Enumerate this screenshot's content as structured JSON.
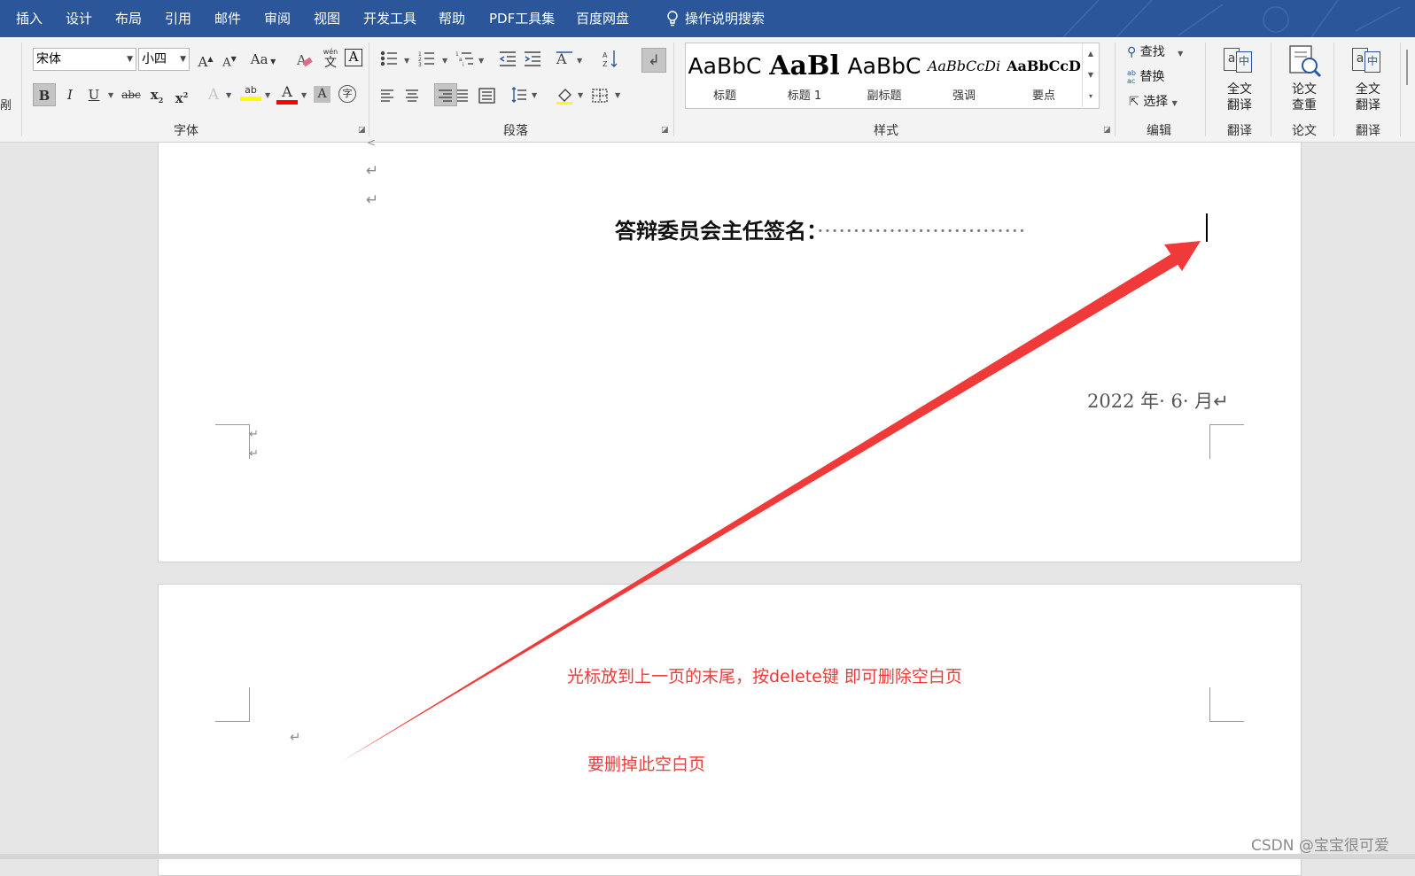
{
  "menu": {
    "tabs": [
      "插入",
      "设计",
      "布局",
      "引用",
      "邮件",
      "审阅",
      "视图",
      "开发工具",
      "帮助",
      "PDF工具集",
      "百度网盘"
    ],
    "tell_me": "操作说明搜索"
  },
  "ribbon": {
    "font": {
      "name": "宋体",
      "size": "小四",
      "label": "字体",
      "grow": "A",
      "shrink": "A",
      "case": "Aa",
      "phonetic_top": "wén",
      "phonetic_bottom": "文",
      "border_char": "A",
      "bold": "B",
      "italic": "I",
      "underline": "U",
      "strike": "abc",
      "subscript": "x",
      "superscript": "x",
      "effects": "A",
      "highlight": "ab",
      "font_color": "A",
      "shading": "A",
      "enclose": "字",
      "highlight_color": "#ffff00",
      "font_color_value": "#ff0000"
    },
    "paragraph": {
      "label": "段落"
    },
    "styles": {
      "label": "样式",
      "items": [
        {
          "sample": "AaBbC",
          "name": "标题"
        },
        {
          "sample": "AaBl",
          "name": "标题 1"
        },
        {
          "sample": "AaBbC",
          "name": "副标题"
        },
        {
          "sample": "AaBbCcDi",
          "name": "强调"
        },
        {
          "sample": "AaBbCcD",
          "name": "要点"
        }
      ]
    },
    "editing": {
      "label": "编辑",
      "find": "查找",
      "replace": "替换",
      "select": "选择",
      "replace_icon_top": "ab",
      "replace_icon_bottom": "ac"
    },
    "translate1": {
      "line1": "全文",
      "line2": "翻译",
      "group": "翻译",
      "icon_char": "a",
      "icon_cn": "中"
    },
    "thesis": {
      "line1": "论文",
      "line2": "查重",
      "group": "论文"
    },
    "translate2": {
      "line1": "全文",
      "line2": "翻译",
      "group": "翻译",
      "icon_char": "a",
      "icon_cn": "中"
    },
    "left_cut_label": "剐"
  },
  "document": {
    "signature_label": "答辩委员会主任签名：",
    "signature_dots": "·····························",
    "date": "2022 年· 6· 月",
    "para_mark": "↵"
  },
  "annotations": {
    "instruction": "光标放到上一页的末尾，按delete键 即可删除空白页",
    "target": "要删掉此空白页",
    "color": "#f03a3a"
  },
  "watermark": "CSDN @宝宝很可爱",
  "colors": {
    "menubar": "#2b579a",
    "ribbon": "#f3f3f3",
    "workspace": "#e6e6e6"
  }
}
